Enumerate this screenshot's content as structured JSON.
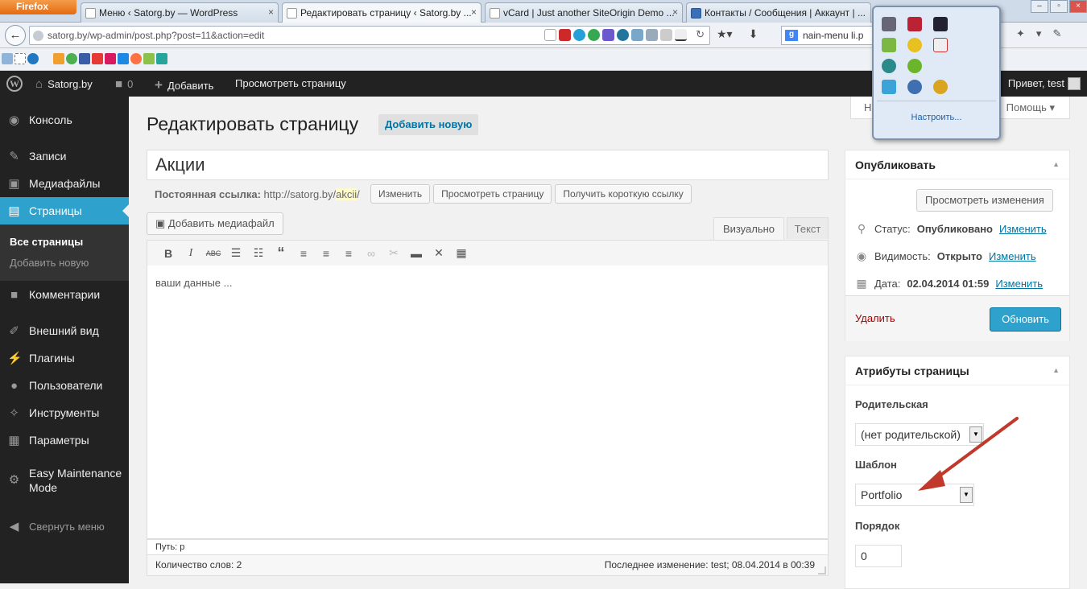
{
  "browser": {
    "app_button": "Firefox",
    "tabs": [
      {
        "title": "Меню ‹ Satorg.by — WordPress",
        "active": false
      },
      {
        "title": "Редактировать страницу ‹ Satorg.by ...",
        "active": true
      },
      {
        "title": "vCard | Just another SiteOrigin Demo ...",
        "active": false
      },
      {
        "title": "Контакты / Сообщения | Аккаунт | ...",
        "active": false
      }
    ],
    "url": "satorg.by/wp-admin/post.php?post=11&action=edit",
    "search_text": "nain-menu li.p",
    "search_engine": "g"
  },
  "adminbar": {
    "site_name": "Satorg.by",
    "comments_count": "0",
    "add_label": "Добавить",
    "view_page": "Просмотреть страницу",
    "greeting": "Привет, test"
  },
  "sidebar": {
    "items": [
      {
        "label": "Консоль",
        "icon": "dashboard-icon"
      },
      {
        "label": "Записи",
        "icon": "pin-icon"
      },
      {
        "label": "Медиафайлы",
        "icon": "media-icon"
      },
      {
        "label": "Страницы",
        "icon": "pages-icon"
      },
      {
        "label": "Комментарии",
        "icon": "comment-icon"
      },
      {
        "label": "Внешний вид",
        "icon": "brush-icon"
      },
      {
        "label": "Плагины",
        "icon": "plug-icon"
      },
      {
        "label": "Пользователи",
        "icon": "user-icon"
      },
      {
        "label": "Инструменты",
        "icon": "wrench-icon"
      },
      {
        "label": "Параметры",
        "icon": "settings-icon"
      },
      {
        "label": "Easy Maintenance Mode",
        "icon": "gear-icon"
      }
    ],
    "submenu": [
      "Все страницы",
      "Добавить новую"
    ],
    "collapse": "Свернуть меню"
  },
  "main": {
    "title": "Редактировать страницу",
    "add_new": "Добавить новую",
    "post_title": "Акции",
    "permalink_label": "Постоянная ссылка:",
    "permalink_base": "http://satorg.by/",
    "permalink_slug": "akcii",
    "permalink_end": "/",
    "btn_change": "Изменить",
    "btn_view": "Просмотреть страницу",
    "btn_shortlink": "Получить короткую ссылку",
    "add_media": "Добавить медиафайл",
    "tab_visual": "Визуально",
    "tab_text": "Текст",
    "content": "ваши данные ...",
    "path": "Путь: p",
    "word_count": "Количество слов: 2",
    "last_edit": "Последнее изменение: test; 08.04.2014 в 00:39"
  },
  "help": {
    "screen_options": "Н",
    "help": "Помощь"
  },
  "publish": {
    "title": "Опубликовать",
    "preview": "Просмотреть изменения",
    "status_label": "Статус:",
    "status_value": "Опубликовано",
    "visibility_label": "Видимость:",
    "visibility_value": "Открыто",
    "date_label": "Дата:",
    "date_value": "02.04.2014 01:59",
    "edit": "Изменить",
    "delete": "Удалить",
    "update": "Обновить"
  },
  "attributes": {
    "title": "Атрибуты страницы",
    "parent_label": "Родительская",
    "parent_value": "(нет родительской)",
    "template_label": "Шаблон",
    "template_value": "Portfolio",
    "order_label": "Порядок",
    "order_value": "0"
  },
  "tray": {
    "customize": "Настроить..."
  },
  "colors": {
    "accent": "#2ea2cc",
    "adminbar": "#222222",
    "arrow": "#c0392b"
  }
}
